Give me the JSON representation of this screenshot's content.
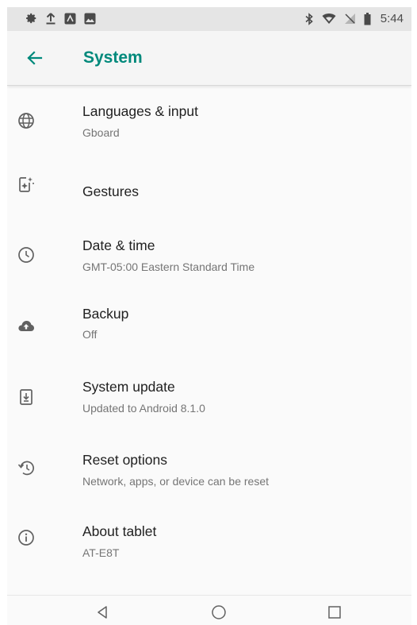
{
  "status_bar": {
    "time": "5:44",
    "left_icons": [
      "settings-icon",
      "upload-icon",
      "notification-icon",
      "image-icon"
    ],
    "right_icons": [
      "bluetooth-icon",
      "wifi-icon",
      "no-sim-icon",
      "battery-icon"
    ]
  },
  "app_bar": {
    "title": "System",
    "back_icon": "arrow-back-icon"
  },
  "items": [
    {
      "title": "Languages & input",
      "subtitle": "Gboard",
      "icon": "globe-icon"
    },
    {
      "title": "Gestures",
      "subtitle": "",
      "icon": "gestures-icon"
    },
    {
      "title": "Date & time",
      "subtitle": "GMT-05:00 Eastern Standard Time",
      "icon": "clock-icon"
    },
    {
      "title": "Backup",
      "subtitle": "Off",
      "icon": "cloud-upload-icon"
    },
    {
      "title": "System update",
      "subtitle": "Updated to Android 8.1.0",
      "icon": "system-update-icon"
    },
    {
      "title": "Reset options",
      "subtitle": "Network, apps, or device can be reset",
      "icon": "restore-icon"
    },
    {
      "title": "About tablet",
      "subtitle": "AT-E8T",
      "icon": "info-icon"
    }
  ],
  "nav_bar": {
    "buttons": [
      "back-nav-icon",
      "home-nav-icon",
      "recents-nav-icon"
    ]
  },
  "colors": {
    "accent": "#00897b",
    "icon_gray": "#616161",
    "primary_text": "#212121",
    "secondary_text": "#757575",
    "status_bar_bg": "#e5e5e5"
  }
}
